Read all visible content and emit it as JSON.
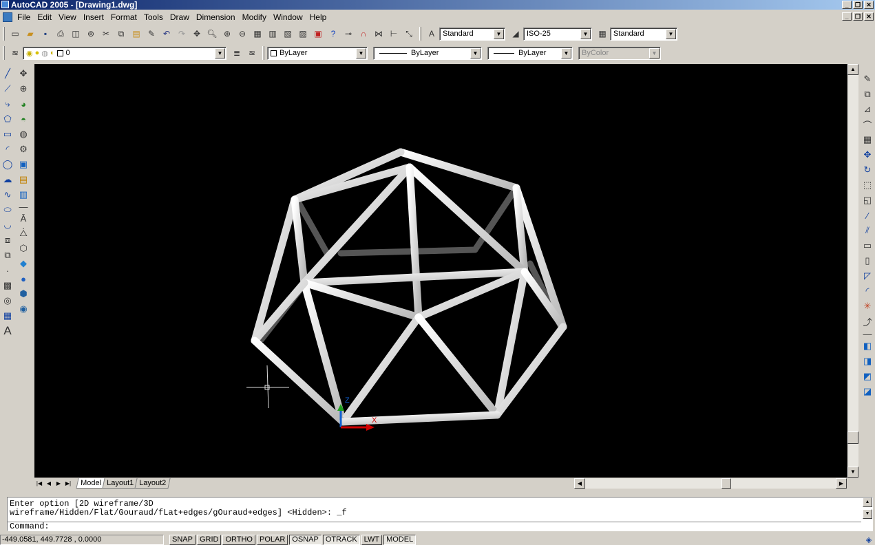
{
  "window": {
    "title": "AutoCAD 2005 - [Drawing1.dwg]"
  },
  "menu": [
    "File",
    "Edit",
    "View",
    "Insert",
    "Format",
    "Tools",
    "Draw",
    "Dimension",
    "Modify",
    "Window",
    "Help"
  ],
  "standard_toolbar": {
    "icons": [
      "new-icon",
      "open-icon",
      "save-icon",
      "plot-icon",
      "plot-preview-icon",
      "publish-icon",
      "cut-icon",
      "copy-icon",
      "paste-icon",
      "match-properties-icon",
      "undo-icon",
      "redo-icon",
      "pan-icon",
      "zoom-realtime-icon",
      "zoom-window-icon",
      "zoom-previous-icon",
      "properties-icon",
      "design-center-icon",
      "tool-palettes-icon",
      "sheet-set-icon",
      "markup-icon",
      "help-icon",
      "snap-icon",
      "magnet-icon",
      "dim-icon",
      "dim2-icon",
      "dim3-icon"
    ]
  },
  "styles": {
    "text_style": "Standard",
    "dim_style": "ISO-25",
    "table_style": "Standard"
  },
  "layers": {
    "current_layer": "0",
    "color": "ByLayer",
    "linetype": "ByLayer",
    "lineweight": "ByLayer",
    "plotstyle": "ByColor"
  },
  "layout_tabs": [
    "Model",
    "Layout1",
    "Layout2"
  ],
  "active_tab": "Model",
  "ucs_labels": {
    "z": "Z",
    "x": "X"
  },
  "command": {
    "history_line1": "Enter option [2D wireframe/3D",
    "history_line2": "wireframe/Hidden/Flat/Gouraud/fLat+edges/gOuraud+edges] <Hidden>: _f",
    "prompt": "Command:"
  },
  "status": {
    "coordinates": "-449.0581, 449.7728 , 0.0000",
    "toggles": [
      {
        "label": "SNAP",
        "on": false
      },
      {
        "label": "GRID",
        "on": false
      },
      {
        "label": "ORTHO",
        "on": false
      },
      {
        "label": "POLAR",
        "on": false
      },
      {
        "label": "OSNAP",
        "on": true
      },
      {
        "label": "OTRACK",
        "on": true
      },
      {
        "label": "LWT",
        "on": false
      },
      {
        "label": "MODEL",
        "on": true
      }
    ]
  },
  "colors": {
    "viewport_bg": "#000000",
    "ucs_x": "#d00000",
    "ucs_y": "#00a000",
    "ucs_z": "#1060d0"
  }
}
